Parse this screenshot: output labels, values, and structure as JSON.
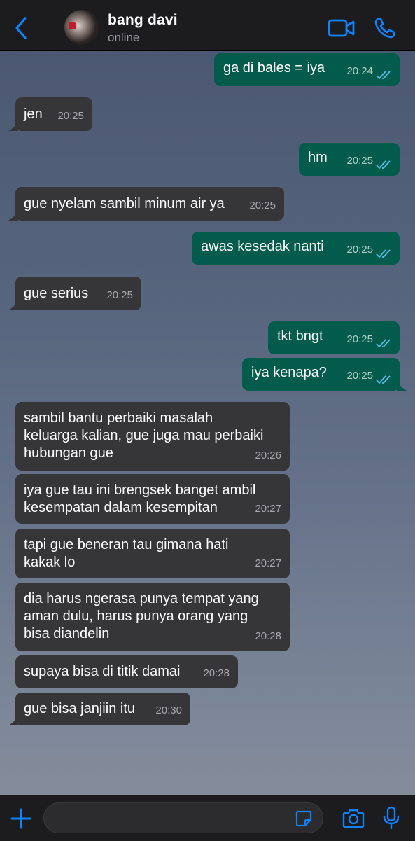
{
  "header": {
    "contact_name": "bang davi",
    "status": "online"
  },
  "messages": [
    {
      "dir": "out",
      "text": "ga di bales = iya",
      "time": "20:24",
      "read": true
    },
    {
      "dir": "in",
      "text": "jen",
      "time": "20:25"
    },
    {
      "dir": "out",
      "text": "hm",
      "time": "20:25",
      "read": true
    },
    {
      "dir": "in",
      "text": "gue nyelam sambil minum air ya",
      "time": "20:25"
    },
    {
      "dir": "out",
      "text": "awas kesedak nanti",
      "time": "20:25",
      "read": true
    },
    {
      "dir": "in",
      "text": "gue serius",
      "time": "20:25"
    },
    {
      "dir": "out",
      "text": "tkt bngt",
      "time": "20:25",
      "read": true
    },
    {
      "dir": "out",
      "text": "iya kenapa?",
      "time": "20:25",
      "read": true
    },
    {
      "dir": "in",
      "lines": [
        "sambil bantu perbaiki masalah",
        "keluarga kalian, gue juga mau perbaiki",
        "hubungan gue"
      ],
      "time": "20:26"
    },
    {
      "dir": "in",
      "lines": [
        "iya gue tau ini brengsek banget ambil",
        "kesempatan dalam kesempitan"
      ],
      "time": "20:27"
    },
    {
      "dir": "in",
      "lines": [
        "tapi gue beneran tau gimana hati",
        "kakak lo"
      ],
      "time": "20:27"
    },
    {
      "dir": "in",
      "lines": [
        "dia harus ngerasa punya tempat yang",
        "aman dulu, harus punya orang yang",
        "bisa diandelin"
      ],
      "time": "20:28"
    },
    {
      "dir": "in",
      "text": "supaya bisa di titik damai",
      "time": "20:28"
    },
    {
      "dir": "in",
      "text": "gue bisa janjiin itu",
      "time": "20:30"
    }
  ],
  "composer": {
    "input_value": "",
    "placeholder": ""
  },
  "colors": {
    "outgoing_bubble": "#035c4b",
    "incoming_bubble": "#363638",
    "accent": "#0a84ff",
    "read_ticks": "#53bdeb"
  }
}
